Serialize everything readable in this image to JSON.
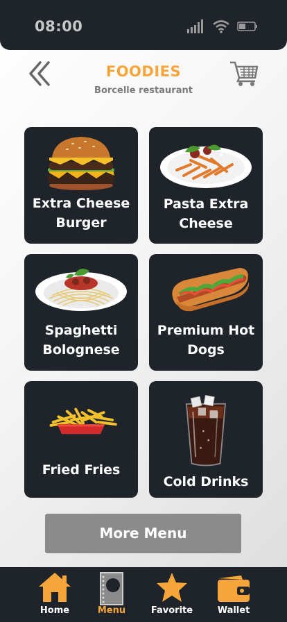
{
  "status": {
    "time": "08:00"
  },
  "header": {
    "title": "FOODIES",
    "subtitle": "Borcelle restaurant"
  },
  "menu": {
    "items": [
      {
        "label_line1": "Extra Cheese",
        "label_line2": "Burger"
      },
      {
        "label_line1": "Pasta Extra",
        "label_line2": "Cheese"
      },
      {
        "label_line1": "Spaghetti",
        "label_line2": "Bolognese"
      },
      {
        "label_line1": "Premium Hot",
        "label_line2": "Dogs"
      },
      {
        "label_line1": "Fried Fries",
        "label_line2": ""
      },
      {
        "label_line1": "Cold Drinks",
        "label_line2": ""
      }
    ]
  },
  "more_button": {
    "label": "More Menu"
  },
  "nav": {
    "items": [
      {
        "label": "Home",
        "icon": "home-icon"
      },
      {
        "label": "Menu",
        "icon": "menu-book-icon"
      },
      {
        "label": "Favorite",
        "icon": "star-icon"
      },
      {
        "label": "Wallet",
        "icon": "wallet-icon"
      }
    ],
    "active_index": 1
  },
  "colors": {
    "accent": "#f5a53a",
    "dark": "#1f232a",
    "button": "#8b8b8b"
  }
}
